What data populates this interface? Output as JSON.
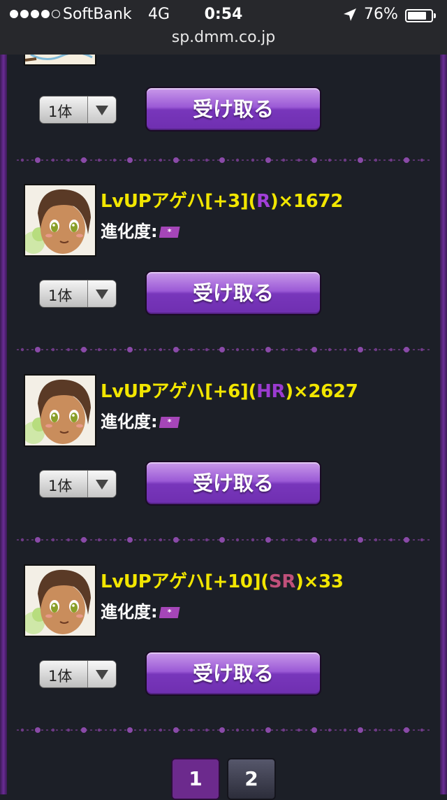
{
  "status_bar": {
    "carrier": "SoftBank",
    "network": "4G",
    "time": "0:54",
    "battery_percent": "76%",
    "battery_level": 0.76,
    "signal_bars": 4,
    "icons": [
      "signal-dots-icon",
      "location-arrow-icon",
      "battery-icon"
    ]
  },
  "url": "sp.dmm.co.jp",
  "receive_button_label": "受け取る",
  "items": [
    {
      "name": "LvUPアゲハ[+3](",
      "rarity": "R",
      "rarity_color": "#a23fd8",
      "count": ")×1672",
      "evolution_label": "進化度:",
      "evolution_badge": "*",
      "quantity": "1体",
      "action_label": "受け取る"
    },
    {
      "name": "LvUPアゲハ[+6](",
      "rarity": "HR",
      "rarity_color": "#9b3bd0",
      "count": ")×2627",
      "evolution_label": "進化度:",
      "evolution_badge": "*",
      "quantity": "1体",
      "action_label": "受け取る"
    },
    {
      "name": "LvUPアゲハ[+10](",
      "rarity": "SR",
      "rarity_color": "#c0507a",
      "count": ")×33",
      "evolution_label": "進化度:",
      "evolution_badge": "*",
      "quantity": "1体",
      "action_label": "受け取る"
    }
  ],
  "top_partial_item": {
    "quantity": "1体",
    "action_label": "受け取る"
  },
  "pagination": {
    "pages": [
      "1",
      "2"
    ],
    "current": "1"
  },
  "colors": {
    "background": "#1c1f27",
    "item_title": "#f2e600",
    "button_purple": "#8a46c8",
    "frame_purple": "#6a2c95"
  }
}
